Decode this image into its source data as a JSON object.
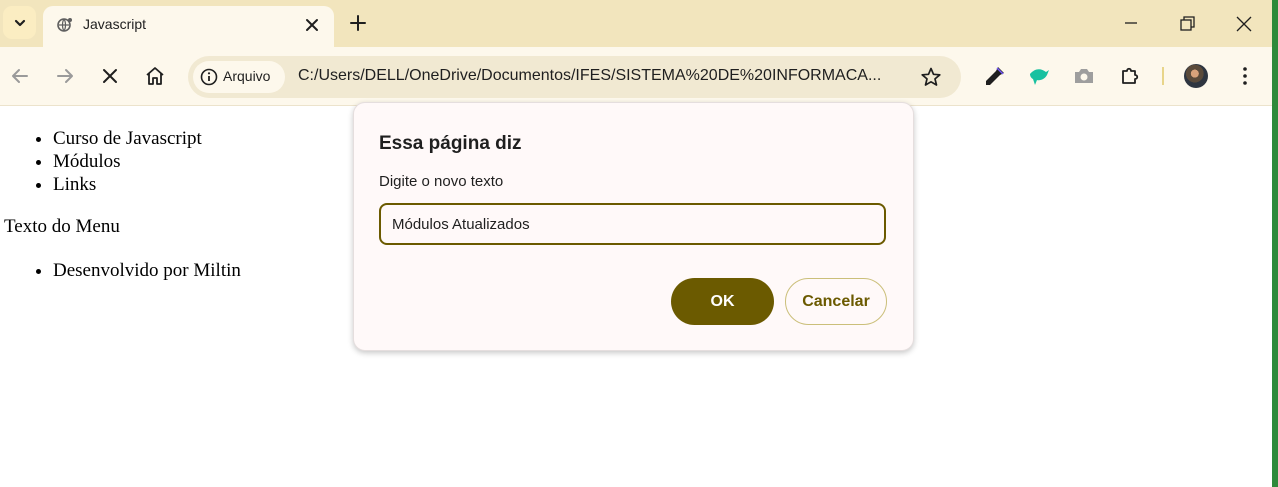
{
  "browser": {
    "tab": {
      "title": "Javascript"
    },
    "address": {
      "security_chip": "Arquivo",
      "url": "C:/Users/DELL/OneDrive/Documentos/IFES/SISTEMA%20DE%20INFORMACA..."
    }
  },
  "page": {
    "menu_items": [
      "Curso de Javascript",
      "Módulos",
      "Links"
    ],
    "menu_text": "Texto do Menu",
    "footer_items": [
      "Desenvolvido por Miltin"
    ]
  },
  "dialog": {
    "title": "Essa página diz",
    "message": "Digite o novo texto",
    "input_value": "Módulos Atualizados",
    "ok_label": "OK",
    "cancel_label": "Cancelar"
  },
  "colors": {
    "accent": "#6b5a00",
    "tabstrip": "#f2e5bd",
    "toolbar": "#fdf8ec"
  }
}
